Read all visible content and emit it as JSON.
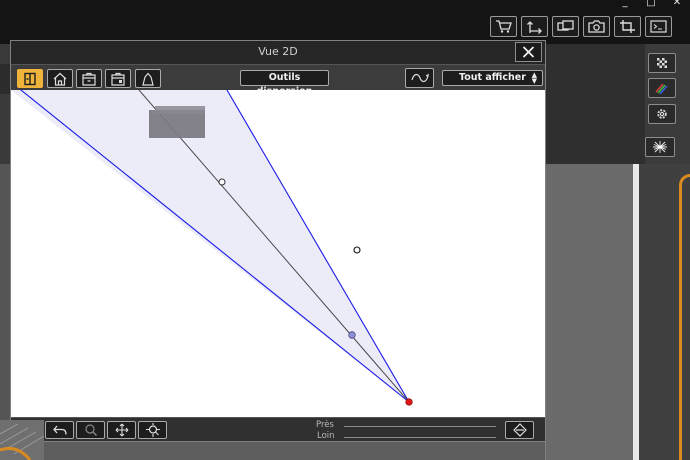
{
  "window_controls": [
    "_",
    "□",
    "✕"
  ],
  "main_toolbar": {
    "icons": [
      "cart-icon",
      "export-icon",
      "display-icon",
      "camera-icon",
      "crop-icon",
      "terminal-icon"
    ]
  },
  "side_buttons": {
    "icons": [
      "checker-icon",
      "lines-icon",
      "gear-icon",
      "starburst-icon"
    ]
  },
  "view2d": {
    "title": "Vue 2D",
    "mode_buttons": [
      "panel-view-icon",
      "house-view-icon",
      "floor-view-icon",
      "room-view-icon",
      "object-view-icon"
    ],
    "active_mode": 0,
    "dispersion_label": "Outils dispersion",
    "view_select_value": "Tout afficher",
    "help_label": "?",
    "near_label": "Près",
    "far_label": "Loin",
    "bottom_icons": [
      "undo-icon",
      "zoom-icon",
      "move-icon",
      "zoom-fit-icon",
      "compass-icon"
    ]
  },
  "colors": {
    "accent": "#f0b43c",
    "frustum_fill": "#ececf8",
    "frustum_edge": "#1a1ae6",
    "camera_point": "#e01616",
    "target_point": "#8f8fd6"
  }
}
